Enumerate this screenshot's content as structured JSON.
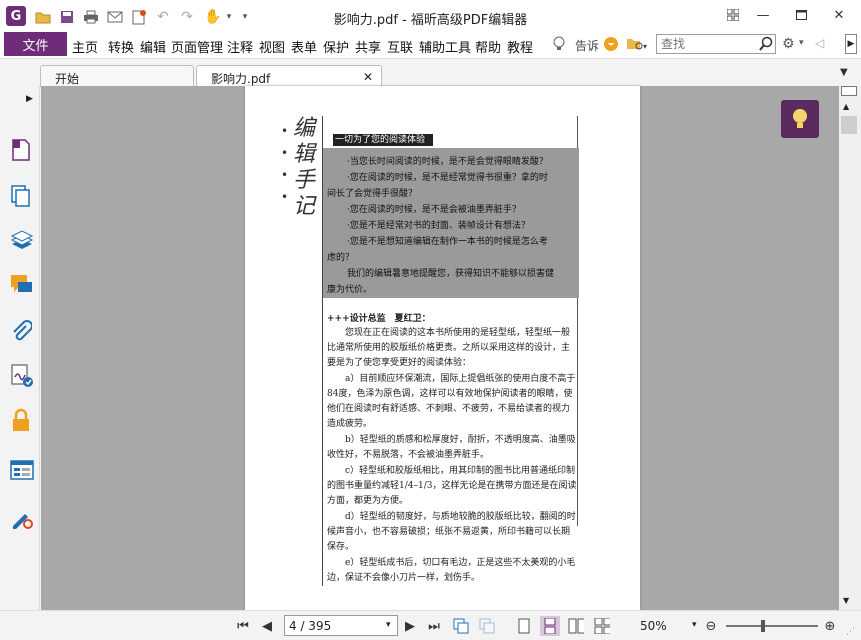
{
  "window": {
    "title": "影响力.pdf - 福昕高级PDF编辑器"
  },
  "quick_access": {
    "icons": [
      "app-logo",
      "open-icon",
      "save-icon",
      "print-icon",
      "email-icon",
      "new-icon",
      "undo-icon",
      "redo-icon",
      "hand-icon"
    ]
  },
  "menu": {
    "file": "文件",
    "items": [
      "主页",
      "转换",
      "编辑",
      "页面管理",
      "注释",
      "视图",
      "表单",
      "保护",
      "共享",
      "互联",
      "辅助工具",
      "帮助",
      "教程"
    ],
    "tell_me": "告诉",
    "search_placeholder": "查找"
  },
  "tabs": [
    {
      "label": "开始",
      "active": false
    },
    {
      "label": "影响力.pdf",
      "active": true
    }
  ],
  "sidebar": {
    "icons": [
      "page-thumbnail-icon",
      "pages-icon",
      "layers-icon",
      "comments-icon",
      "attachments-icon",
      "signature-icon",
      "security-icon",
      "form-fields-icon",
      "certify-icon"
    ]
  },
  "page_content": {
    "vertical_title": [
      "编",
      "辑",
      "手",
      "记"
    ],
    "banner": "一切为了您的阅读体验",
    "grey_lines": [
      "·当您长时间阅读的时候，是不是会觉得眼睛发酸？",
      "·您在阅读的时候，是不是经常觉得书很重？拿的时",
      "间长了会觉得手很酸？",
      "·您在阅读的时候，是不是会被油墨弄脏手？",
      "·您是不是经常对书的封面、装帧设计有想法？",
      "·您是不是想知道编辑在制作一本书的时候是怎么考",
      "虑的？",
      "我们的编辑暑意地提醒您，获得知识不能够以损害健",
      "康为代价。"
    ],
    "designer": "+++设计总监　夏红卫：",
    "paragraphs": [
      "　　您现在正在阅读的这本书所使用的是轻型纸，轻型纸一般比通常所使用的胶版纸价格更贵。之所以采用这样的设计，主要是为了使您享受更好的阅读体验：",
      "　　a）目前顺应环保潮流，国际上提倡纸张的使用白度不高于84度，色泽为原色调，这样可以有效地保护阅读者的眼睛，使他们在阅读时有舒适感、不刺眼、不疲劳，不易给读者的视力造成疲劳。",
      "　　b）轻型纸的质感和松厚度好，耐折，不透明度高、油墨吸收性好，不易脱落，不会被油墨弄脏手。",
      "　　c）轻型纸和胶版纸相比，用其印制的图书比用普通纸印制的图书重量约减轻1/4–1/3，这样无论是在携带方面还是在阅读方面，都更为方便。",
      "　　d）轻型纸的韧度好，与质地较脆的胶版纸比较，翻阅的时候声音小，也不容易破损；纸张不易返黄，所印书籍可以长期保存。",
      "　　e）轻型纸成书后，切口有毛边，正是这些不太美观的小毛边，保证不会像小刀片一样，划伤手。"
    ]
  },
  "status": {
    "page_indicator": "4 / 395",
    "zoom": "50%",
    "zoom_fraction": 0.4
  },
  "colors": {
    "accent": "#6f2c79",
    "doc_background": "#a8a8a8",
    "bulb_bg": "#5b2a5e"
  }
}
